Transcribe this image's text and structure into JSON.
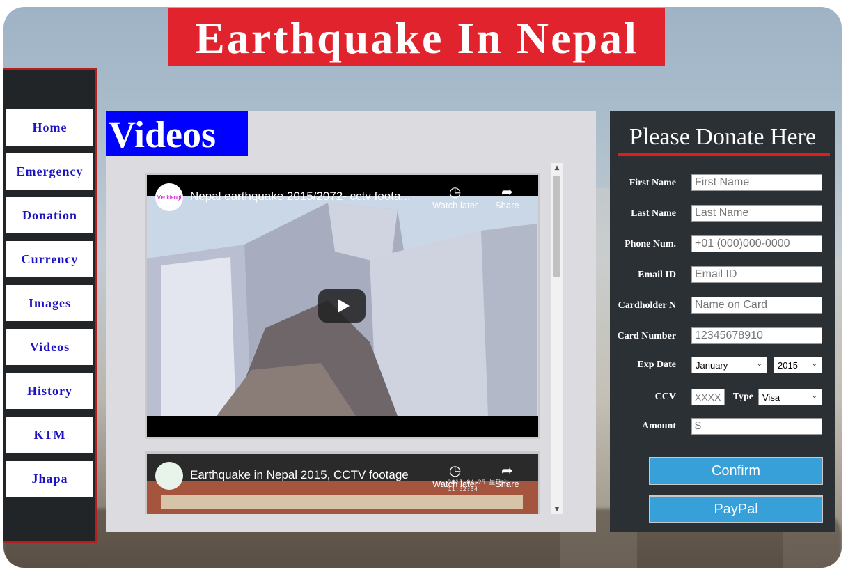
{
  "page": {
    "title": "Earthquake In Nepal"
  },
  "nav": {
    "items": [
      {
        "label": "Home"
      },
      {
        "label": "Emergency"
      },
      {
        "label": "Donation"
      },
      {
        "label": "Currency"
      },
      {
        "label": "Images"
      },
      {
        "label": "Videos"
      },
      {
        "label": "History"
      },
      {
        "label": "KTM"
      },
      {
        "label": "Jhapa"
      }
    ]
  },
  "main": {
    "heading": "Videos",
    "videos": [
      {
        "title": "Nepal earthquake 2015/2072- cctv foota...",
        "channel_badge": "Venkiengi",
        "watch_later": "Watch later",
        "share": "Share"
      },
      {
        "title": "Earthquake in Nepal 2015, CCTV footage",
        "watch_later": "Watch later",
        "share": "Share",
        "timestamp_overlay": "2015-04-25 星期六 11:52:34"
      }
    ]
  },
  "donate": {
    "heading": "Please Donate Here",
    "fields": {
      "first_name": {
        "label": "First Name",
        "placeholder": "First Name"
      },
      "last_name": {
        "label": "Last Name",
        "placeholder": "Last Name"
      },
      "phone": {
        "label": "Phone Num.",
        "placeholder": "+01 (000)000-0000"
      },
      "email": {
        "label": "Email ID",
        "placeholder": "Email ID"
      },
      "cardholder": {
        "label": "Cardholder N",
        "placeholder": "Name on Card"
      },
      "card_number": {
        "label": "Card Number",
        "placeholder": "12345678910"
      },
      "exp_date": {
        "label": "Exp Date",
        "month": "January",
        "year": "2015"
      },
      "ccv": {
        "label": "CCV",
        "placeholder": "XXXX"
      },
      "type": {
        "label": "Type",
        "value": "Visa"
      },
      "amount": {
        "label": "Amount",
        "placeholder": "$"
      }
    },
    "confirm_label": "Confirm",
    "paypal_label": "PayPal"
  },
  "colors": {
    "title_bg": "#e0232c",
    "videos_heading_bg": "#0000ff",
    "nav_text": "#1c12c4",
    "button_bg": "#37a0d9",
    "donate_bg": "#2b3035"
  }
}
